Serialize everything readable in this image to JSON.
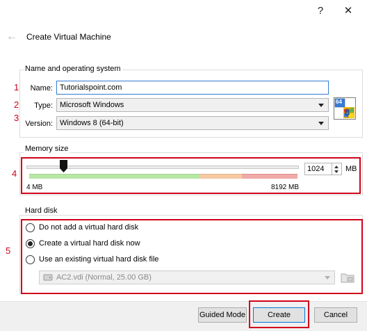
{
  "window": {
    "help_label": "?",
    "close_label": "✕"
  },
  "header": {
    "back_arrow": "←",
    "title": "Create Virtual Machine"
  },
  "name_os": {
    "group_title": "Name and operating system",
    "name_label": "Name:",
    "name_value": "Tutorialspoint.com",
    "type_label": "Type:",
    "type_value": "Microsoft Windows",
    "version_label": "Version:",
    "version_value": "Windows 8 (64-bit)",
    "os_icon": {
      "badge": "64",
      "digit": "8"
    }
  },
  "memory": {
    "group_title": "Memory size",
    "min_label": "4 MB",
    "max_label": "8192 MB",
    "value": "1024",
    "unit": "MB",
    "slider_fraction": 0.125
  },
  "hard_disk": {
    "group_title": "Hard disk",
    "options": [
      {
        "label": "Do not add a virtual hard disk",
        "checked": false
      },
      {
        "label": "Create a virtual hard disk now",
        "checked": true
      },
      {
        "label": "Use an existing virtual hard disk file",
        "checked": false
      }
    ],
    "existing_file": "AC2.vdi (Normal, 25.00 GB)"
  },
  "annotations": {
    "n1": "1",
    "n2": "2",
    "n3": "3",
    "n4": "4",
    "n5": "5"
  },
  "buttons": {
    "guided_mode": "Guided Mode",
    "create": "Create",
    "cancel": "Cancel"
  },
  "colors": {
    "annotation_red": "#d0021b",
    "focus_blue": "#2f7bd6",
    "zone_green": "#b8e6a6",
    "zone_orange": "#f5c9a4",
    "zone_red": "#f0aaa9"
  }
}
